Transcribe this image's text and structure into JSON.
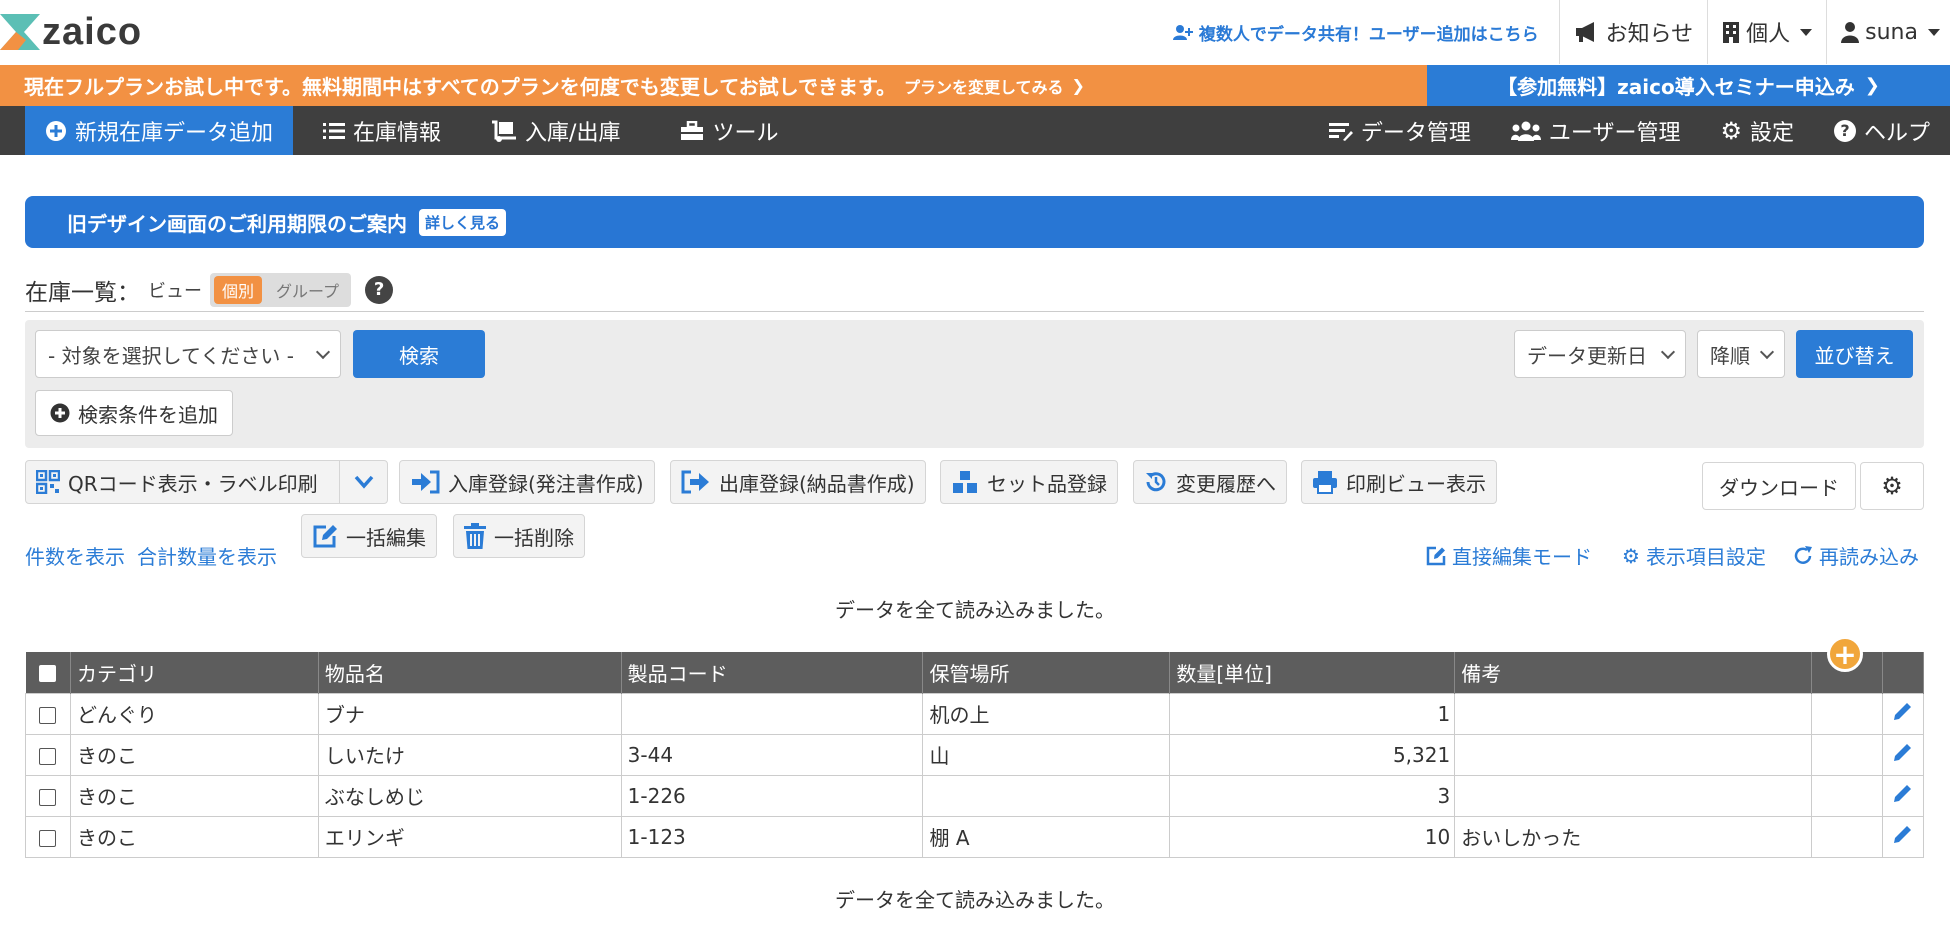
{
  "header": {
    "logo_text": "zaico",
    "share_link": "複数人でデータ共有！ユーザー追加はこちら",
    "notice_label": "お知らせ",
    "account_type": "個人",
    "user_name": "suna"
  },
  "banner": {
    "trial_text": "現在フルプランお試し中です。無料期間中はすべてのプランを何度でも変更してお試しできます。",
    "trial_link": "プランを変更してみる",
    "seminar": "【参加無料】zaico導入セミナー申込み"
  },
  "nav": {
    "add_new": "新規在庫データ追加",
    "inventory": "在庫情報",
    "inout": "入庫/出庫",
    "tools": "ツール",
    "data_mgmt": "データ管理",
    "user_mgmt": "ユーザー管理",
    "settings": "設定",
    "help": "ヘルプ"
  },
  "notice": {
    "text": "旧デザイン画面のご利用期限のご案内",
    "detail": "詳しく見る"
  },
  "list": {
    "title": "在庫一覧：",
    "view_label": "ビュー",
    "toggle_individual": "個別",
    "toggle_group": "グループ",
    "help": "?"
  },
  "search": {
    "target_select": "- 対象を選択してください -",
    "search_button": "検索",
    "add_condition": "検索条件を追加",
    "sort_field": "データ更新日",
    "sort_order": "降順",
    "sort_button": "並び替え"
  },
  "toolbar": {
    "qr": "QRコード表示・ラベル印刷",
    "inbound": "入庫登録(発注書作成)",
    "outbound": "出庫登録(納品書作成)",
    "set_item": "セット品登録",
    "history": "変更履歴へ",
    "print_view": "印刷ビュー表示",
    "download": "ダウンロード",
    "bulk_edit": "一括編集",
    "bulk_delete": "一括削除",
    "show_count": "件数を表示",
    "show_total": "合計数量を表示",
    "direct_edit": "直接編集モード",
    "display_settings": "表示項目設定",
    "reload": "再読み込み",
    "loaded_msg": "データを全て読み込みました。"
  },
  "table": {
    "columns": [
      "カテゴリ",
      "物品名",
      "製品コード",
      "保管場所",
      "数量[単位]",
      "備考"
    ],
    "rows": [
      {
        "category": "どんぐり",
        "name": "ブナ",
        "code": "",
        "location": "机の上",
        "qty": "1",
        "note": ""
      },
      {
        "category": "きのこ",
        "name": "しいたけ",
        "code": "3-44",
        "location": "山",
        "qty": "5,321",
        "note": ""
      },
      {
        "category": "きのこ",
        "name": "ぶなしめじ",
        "code": "1-226",
        "location": "",
        "qty": "3",
        "note": ""
      },
      {
        "category": "きのこ",
        "name": "エリンギ",
        "code": "1-123",
        "location": "棚 A",
        "qty": "10",
        "note": "おいしかった"
      }
    ]
  },
  "colors": {
    "accent_blue": "#2b7cd6",
    "accent_orange": "#f29143",
    "nav_dark": "#3f3f3f"
  }
}
